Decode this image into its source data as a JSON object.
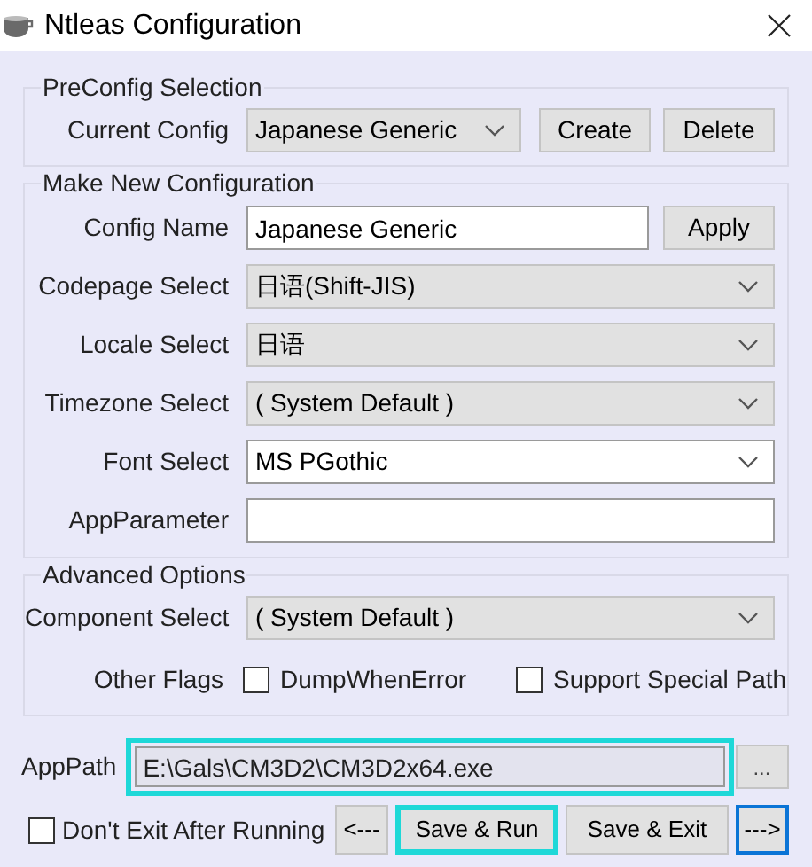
{
  "window": {
    "title": "Ntleas Configuration"
  },
  "preconfig": {
    "title": "PreConfig Selection",
    "label": "Current Config",
    "value": "Japanese Generic",
    "buttons": [
      "Create",
      "Delete"
    ]
  },
  "new_config": {
    "title": "Make New Configuration",
    "rows": [
      {
        "kind": "input",
        "label": "Config Name",
        "value": "Japanese Generic",
        "button": "Apply"
      },
      {
        "kind": "dropdown",
        "label": "Codepage Select",
        "value": "日语(Shift-JIS)"
      },
      {
        "kind": "dropdown",
        "label": "Locale Select",
        "value": "日语"
      },
      {
        "kind": "dropdown",
        "label": "Timezone Select",
        "value": "( System Default )"
      },
      {
        "kind": "combo",
        "label": "Font Select",
        "value": "MS PGothic"
      },
      {
        "kind": "input",
        "label": "AppParameter"
      }
    ]
  },
  "advanced": {
    "title": "Advanced Options",
    "component": {
      "label": "Component Select",
      "value": "( System Default )"
    },
    "flags_label": "Other Flags",
    "flags": [
      {
        "label": "DumpWhenError",
        "checked": false
      },
      {
        "label": "Support Special Path",
        "checked": false
      }
    ]
  },
  "app_path": {
    "label": "AppPath",
    "value": "E:\\Gals\\CM3D2\\CM3D2x64.exe",
    "highlighted": true,
    "browse": "..."
  },
  "dont_exit": {
    "label": "Don't Exit After Running",
    "checked": false
  },
  "nav_buttons": [
    {
      "label": "<---",
      "highlighted": false,
      "focused": false
    },
    {
      "label": "Save & Run",
      "highlighted": true,
      "focused": false
    },
    {
      "label": "Save & Exit",
      "highlighted": false,
      "focused": false
    },
    {
      "label": "--->",
      "highlighted": false,
      "focused": true
    }
  ]
}
